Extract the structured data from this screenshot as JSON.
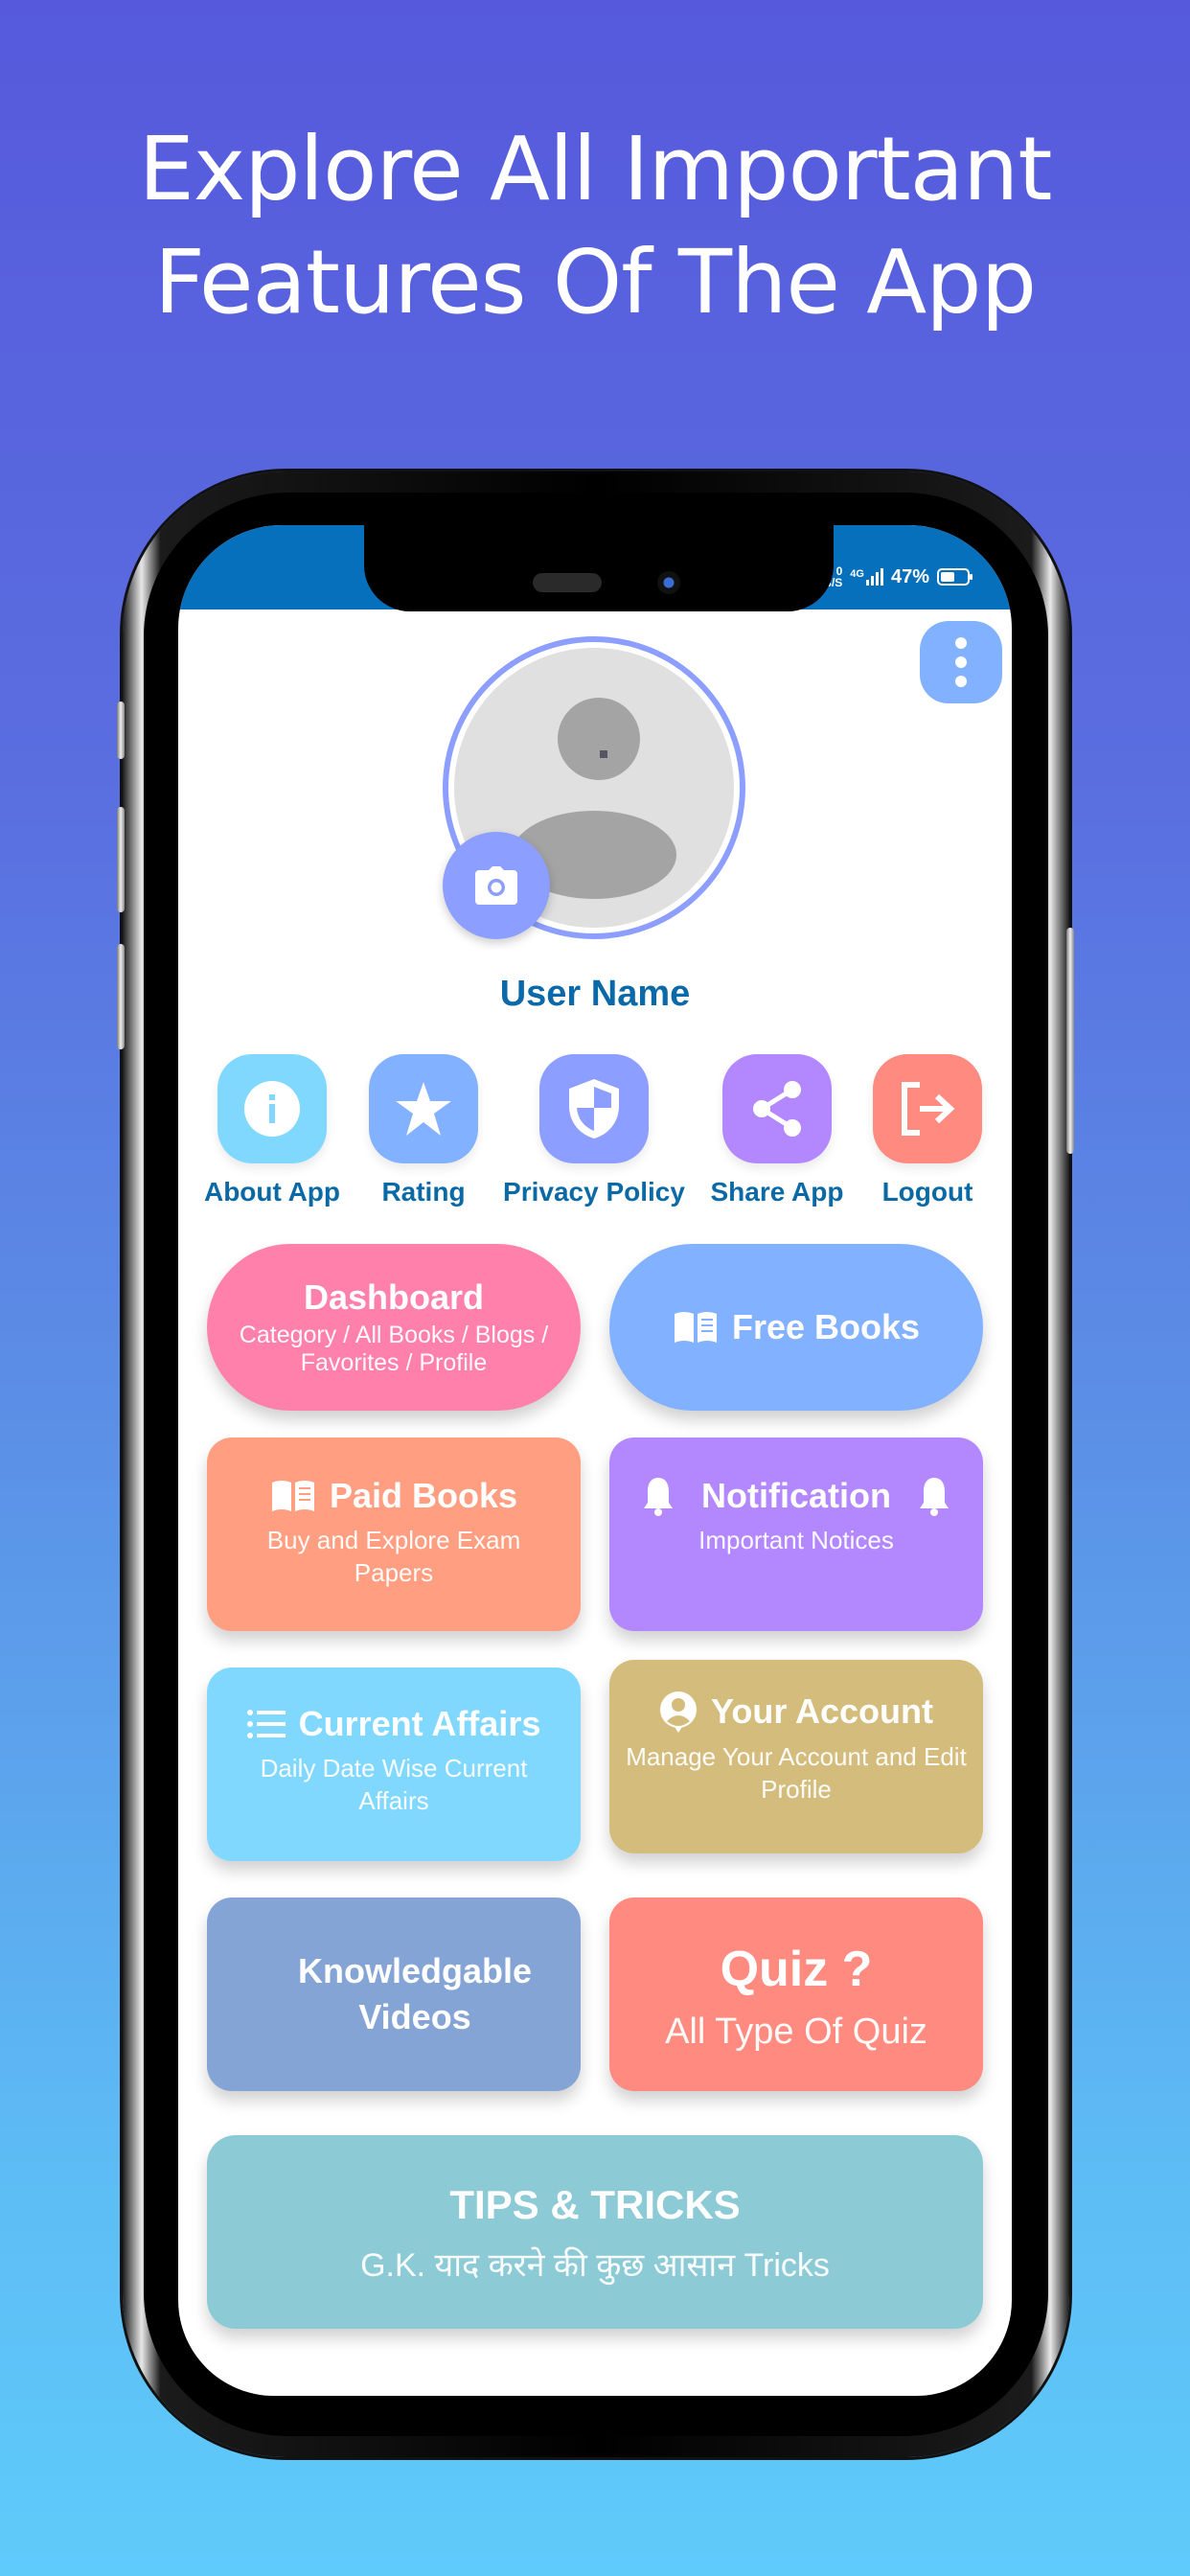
{
  "headline": {
    "line1": "Explore All Important",
    "line2": "Features Of The App"
  },
  "status_bar": {
    "net_speed_value": "0",
    "net_speed_unit": "KB/S",
    "network": "4G",
    "battery_percent": "47%",
    "battery_level": 0.47
  },
  "profile": {
    "username": "User Name",
    "menu_icon": "more-vertical-icon",
    "camera_icon": "camera-icon"
  },
  "quick_actions": [
    {
      "label": "About App",
      "icon": "info-icon",
      "color": "#80d8ff"
    },
    {
      "label": "Rating",
      "icon": "star-icon",
      "color": "#82b1ff"
    },
    {
      "label": "Privacy Policy",
      "icon": "shield-icon",
      "color": "#8c9eff"
    },
    {
      "label": "Share App",
      "icon": "share-icon",
      "color": "#b388ff"
    },
    {
      "label": "Logout",
      "icon": "logout-icon",
      "color": "#ff8a80"
    }
  ],
  "cards": {
    "dashboard": {
      "title": "Dashboard",
      "subtitle": "Category / All Books / Blogs / Favorites / Profile",
      "color": "#ff80ab"
    },
    "free_books": {
      "title": "Free Books",
      "icon": "book-open-icon",
      "color": "#82b1ff"
    },
    "paid_books": {
      "title": "Paid Books",
      "subtitle": "Buy and Explore Exam Papers",
      "icon": "book-open-icon",
      "color": "#ff9e80"
    },
    "notification": {
      "title": "Notification",
      "subtitle": "Important Notices",
      "icon": "bell-icon",
      "color": "#b388ff"
    },
    "current_affairs": {
      "title": "Current Affairs",
      "subtitle": "Daily Date Wise Current Affairs",
      "icon": "list-icon",
      "color": "#80d8ff"
    },
    "your_account": {
      "title": "Your Account",
      "subtitle": "Manage Your Account and Edit Profile",
      "icon": "account-circle-icon",
      "color": "#d4bc7c"
    },
    "videos": {
      "title": "Knowledgable Videos",
      "color": "#84a4d6"
    },
    "quiz": {
      "title": "Quiz ?",
      "subtitle": "All Type Of Quiz",
      "color": "#ff8a80"
    },
    "tips": {
      "title": "TIPS & TRICKS",
      "subtitle": "G.K. याद करने की कुछ आसान Tricks",
      "color": "#8ccbd6"
    }
  }
}
